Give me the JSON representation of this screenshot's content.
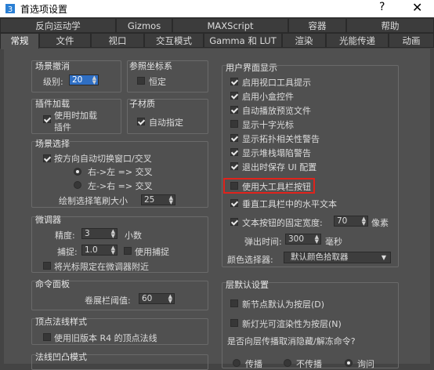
{
  "window": {
    "title": "首选项设置",
    "help": "?",
    "close": "✕"
  },
  "tabs_row1": [
    "反向运动学",
    "Gizmos",
    "MAXScript",
    "容器",
    "帮助"
  ],
  "tabs_row2": [
    "常规",
    "文件",
    "视口",
    "交互模式",
    "Gamma 和 LUT",
    "渲染",
    "光能传递",
    "动画"
  ],
  "active_tab": "常规",
  "scene_undo": {
    "title": "场景撤消",
    "level_label": "级别:",
    "level_value": "20"
  },
  "ref_coord": {
    "title": "参照坐标系",
    "constant_label": "恒定"
  },
  "plugin_loading": {
    "title": "插件加载",
    "load_on_use_label": "使用时加载插件"
  },
  "sub_material": {
    "title": "子材质",
    "auto_assign_label": "自动指定"
  },
  "scene_selection": {
    "title": "场景选择",
    "auto_switch_label": "按方向自动切换窗口/交叉",
    "right_to_left_label": "右->左 => 交叉",
    "left_to_right_label": "左->右 => 交叉",
    "brush_size_label": "绘制选择笔刷大小",
    "brush_size_value": "25"
  },
  "spinners": {
    "title": "微调器",
    "precision_label": "精度:",
    "precision_value": "3",
    "decimals_label": "小数",
    "snap_label": "捕捉:",
    "snap_value": "1.0",
    "use_snap_label": "使用捕捉",
    "wrap_cursor_label": "将光标限定在微调器附近"
  },
  "command_panel": {
    "title": "命令面板",
    "rollout_threshold_label": "卷展栏阈值:",
    "rollout_threshold_value": "60"
  },
  "vertex_normal": {
    "title": "顶点法线样式",
    "use_legacy_label": "使用旧版本 R4 的顶点法线"
  },
  "normal_bump": {
    "title": "法线凹凸模式"
  },
  "ui_display": {
    "title": "用户界面显示",
    "items": [
      {
        "label": "启用视口工具提示",
        "checked": true
      },
      {
        "label": "启用小盒控件",
        "checked": true
      },
      {
        "label": "自动播放预览文件",
        "checked": true
      },
      {
        "label": "显示十字光标",
        "checked": false
      },
      {
        "label": "显示拓扑相关性警告",
        "checked": true
      },
      {
        "label": "显示堆栈塌陷警告",
        "checked": true
      },
      {
        "label": "退出时保存 UI 配置",
        "checked": true
      },
      {
        "label": "使用大工具栏按钮",
        "checked": false
      },
      {
        "label": "垂直工具栏中的水平文本",
        "checked": true
      }
    ],
    "fixed_width_label": "文本按钮的固定宽度:",
    "fixed_width_value": "70",
    "pixels_label": "像素",
    "flyout_label": "弹出时间:",
    "flyout_value": "300",
    "ms_label": "毫秒",
    "color_picker_label": "颜色选择器:",
    "color_picker_value": "默认颜色拾取器"
  },
  "layer_defaults": {
    "title": "层默认设置",
    "new_nodes_label": "新节点默认为按层(D)",
    "new_lights_label": "新灯光可渲染性为按层(N)",
    "propagate_question": "是否向层传播取消隐藏/解冻命令?",
    "opt1": "传播",
    "opt2": "不传播",
    "opt3": "询问"
  }
}
